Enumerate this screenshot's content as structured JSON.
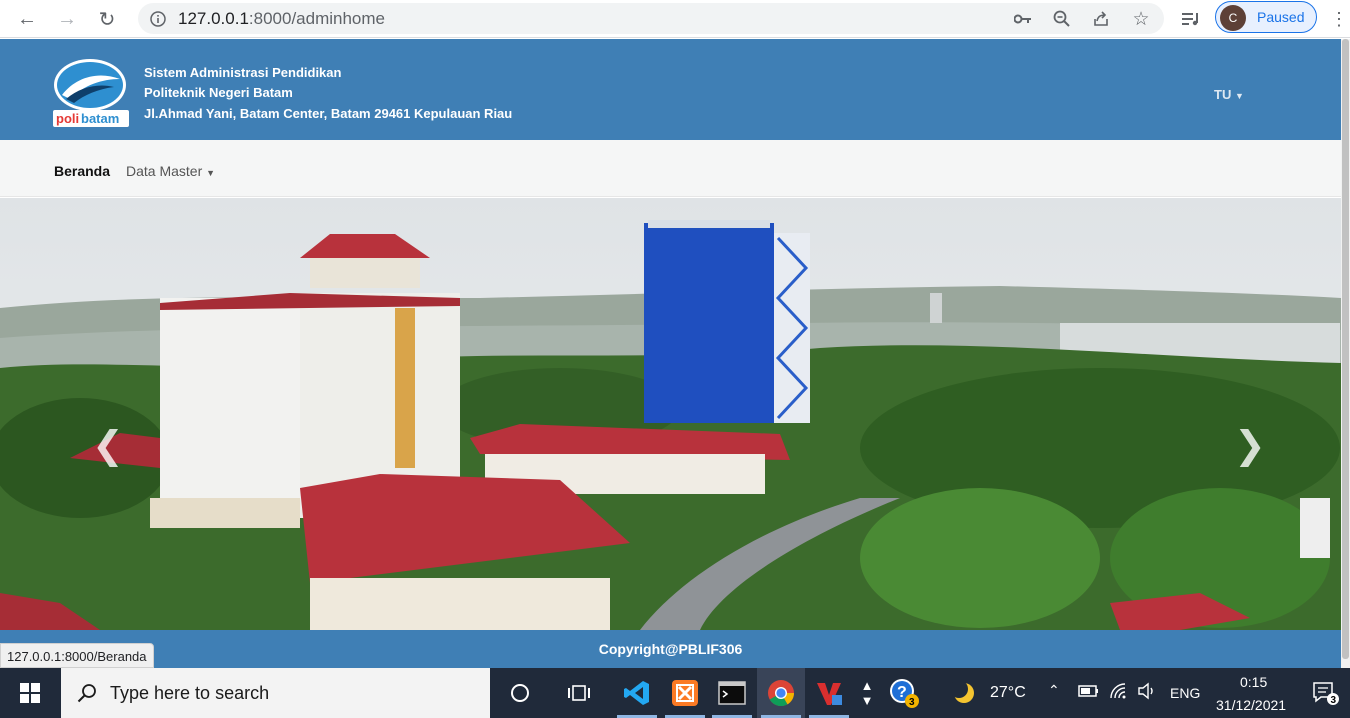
{
  "browser": {
    "url_host": "127.0.0.1",
    "url_rest": ":8000/adminhome",
    "profile_initial": "C",
    "profile_status": "Paused"
  },
  "header": {
    "line1": "Sistem Administrasi Pendidikan",
    "line2": "Politeknik Negeri Batam",
    "line3": "Jl.Ahmad Yani, Batam Center, Batam 29461 Kepulauan Riau",
    "logo_text_a": "poli",
    "logo_text_b": "batam",
    "user_menu": "TU"
  },
  "nav": {
    "home": "Beranda",
    "master": "Data Master"
  },
  "footer": {
    "copyright": "Copyright@PBLIF306"
  },
  "status_url": "127.0.0.1:8000/Beranda",
  "taskbar": {
    "search_placeholder": "Type here to search",
    "temperature": "27°C",
    "language": "ENG",
    "time": "0:15",
    "date": "31/12/2021",
    "notification_count": "3",
    "help_badge": "3"
  },
  "colors": {
    "brand_blue": "#3f7fb5",
    "taskbar": "#202a3a"
  }
}
